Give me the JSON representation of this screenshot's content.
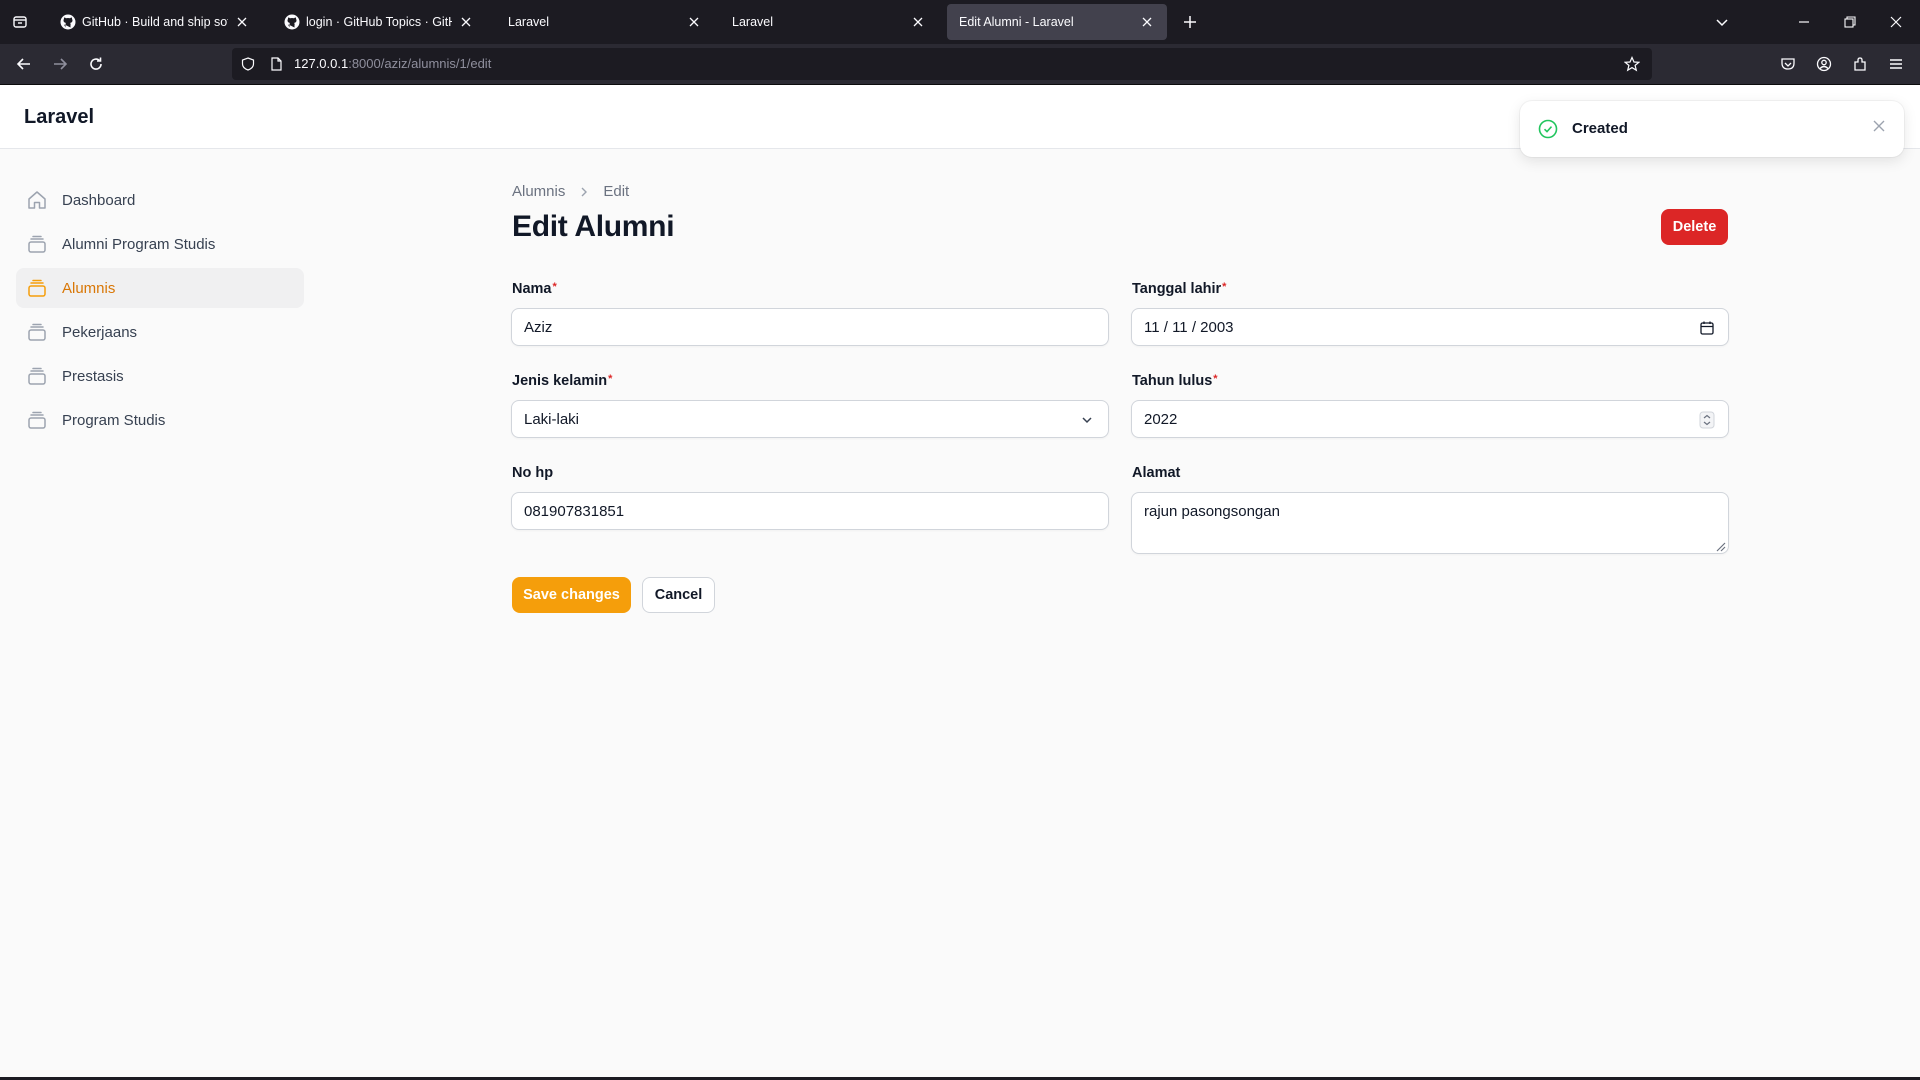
{
  "browser": {
    "tabs": [
      {
        "title": "GitHub · Build and ship softwar",
        "favicon": "github-icon",
        "active": false
      },
      {
        "title": "login · GitHub Topics · GitHub",
        "favicon": "github-icon",
        "active": false
      },
      {
        "title": "Laravel",
        "favicon": "",
        "active": false
      },
      {
        "title": "Laravel",
        "favicon": "",
        "active": false
      },
      {
        "title": "Edit Alumni - Laravel",
        "favicon": "",
        "active": true
      }
    ],
    "url_host": "127.0.0.1",
    "url_rest": ":8000/aziz/alumnis/1/edit"
  },
  "app": {
    "brand": "Laravel"
  },
  "sidebar": {
    "items": [
      {
        "label": "Dashboard",
        "icon": "home-icon",
        "active": false
      },
      {
        "label": "Alumni Program Studis",
        "icon": "collection-icon",
        "active": false
      },
      {
        "label": "Alumnis",
        "icon": "collection-icon",
        "active": true
      },
      {
        "label": "Pekerjaans",
        "icon": "collection-icon",
        "active": false
      },
      {
        "label": "Prestasis",
        "icon": "collection-icon",
        "active": false
      },
      {
        "label": "Program Studis",
        "icon": "collection-icon",
        "active": false
      }
    ]
  },
  "breadcrumb": {
    "parent": "Alumnis",
    "current": "Edit"
  },
  "page": {
    "title": "Edit Alumni",
    "delete_label": "Delete"
  },
  "form": {
    "nama": {
      "label": "Nama",
      "required": "*",
      "value": "Aziz"
    },
    "tanggal_lahir": {
      "label": "Tanggal lahir",
      "required": "*",
      "value": "11 / 11 / 2003"
    },
    "jenis_kelamin": {
      "label": "Jenis kelamin",
      "required": "*",
      "value": "Laki-laki"
    },
    "tahun_lulus": {
      "label": "Tahun lulus",
      "required": "*",
      "value": "2022"
    },
    "no_hp": {
      "label": "No hp",
      "value": "081907831851"
    },
    "alamat": {
      "label": "Alamat",
      "value": "rajun pasongsongan"
    },
    "save_label": "Save changes",
    "cancel_label": "Cancel"
  },
  "toast": {
    "message": "Created"
  },
  "colors": {
    "primary": "#f59e0b",
    "danger": "#dc2626",
    "success": "#22c55e"
  }
}
